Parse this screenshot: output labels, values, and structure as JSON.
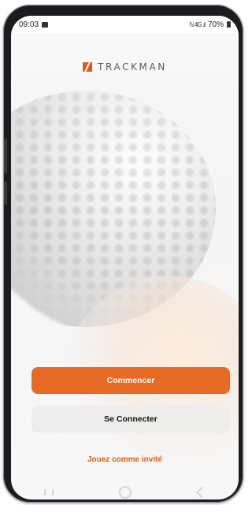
{
  "status_bar": {
    "time": "09:03",
    "signal": "ℕ 4G .ıl",
    "battery": "70%"
  },
  "brand": {
    "name": "TRACKMAN",
    "accent_color": "#e05818"
  },
  "actions": {
    "start_label": "Commencer",
    "login_label": "Se Connecter",
    "guest_label": "Jouez comme invité"
  },
  "icons": {
    "message": "message-icon",
    "battery": "battery-icon",
    "logo": "trackman-logo-icon"
  }
}
